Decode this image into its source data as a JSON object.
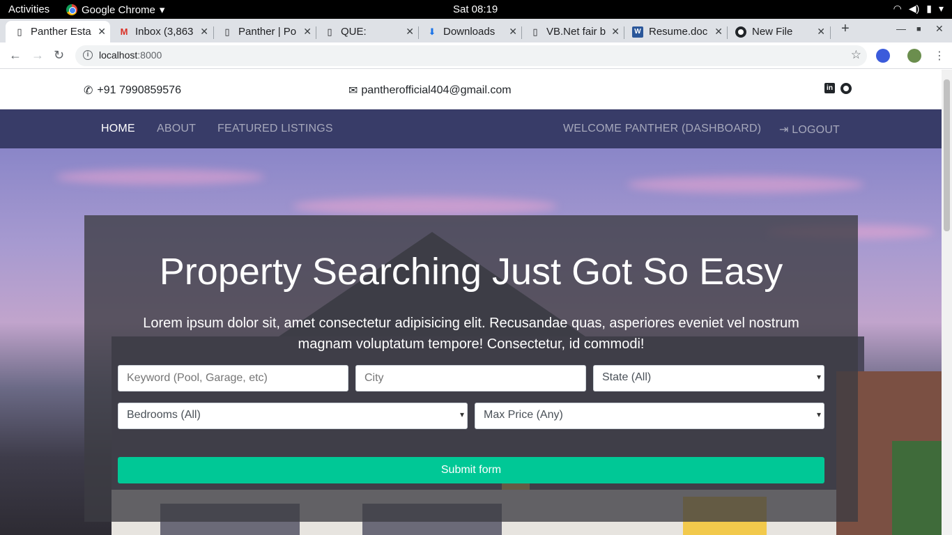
{
  "os": {
    "activities": "Activities",
    "app_name": "Google Chrome",
    "clock": "Sat 08:19"
  },
  "browser": {
    "tabs": [
      {
        "title": "Panther Esta",
        "icon": "page-icon"
      },
      {
        "title": "Inbox (3,863",
        "icon": "gmail-icon"
      },
      {
        "title": "Panther | Po",
        "icon": "page-icon"
      },
      {
        "title": "QUE:",
        "icon": "page-icon"
      },
      {
        "title": "Downloads",
        "icon": "download-icon"
      },
      {
        "title": "VB.Net fair b",
        "icon": "page-icon"
      },
      {
        "title": "Resume.doc",
        "icon": "word-icon"
      },
      {
        "title": "New File",
        "icon": "github-icon"
      }
    ],
    "url_host": "localhost",
    "url_port": ":8000"
  },
  "contact": {
    "phone": "+91 7990859576",
    "email": "pantherofficial404@gmail.com"
  },
  "nav": {
    "home": "HOME",
    "about": "ABOUT",
    "featured": "FEATURED LISTINGS",
    "welcome": "WELCOME PANTHER (DASHBOARD)",
    "logout": "LOGOUT"
  },
  "hero": {
    "title": "Property Searching Just Got So Easy",
    "text": "Lorem ipsum dolor sit, amet consectetur adipisicing elit. Recusandae quas, asperiores eveniet vel nostrum magnam voluptatum tempore! Consectetur, id commodi!"
  },
  "search": {
    "keyword_placeholder": "Keyword (Pool, Garage, etc)",
    "city_placeholder": "City",
    "state_selected": "State (All)",
    "bedrooms_selected": "Bedrooms (All)",
    "price_selected": "Max Price (Any)",
    "submit_label": "Submit form"
  },
  "colors": {
    "navbar": "#383c68",
    "accent": "#00c896"
  }
}
